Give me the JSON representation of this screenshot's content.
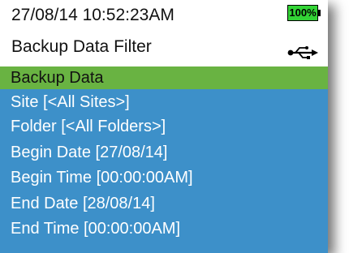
{
  "status": {
    "datetime": "27/08/14  10:52:23AM",
    "battery_label": "100%",
    "battery_level": 1.0
  },
  "header": {
    "title": "Backup Data Filter",
    "icon": "usb-icon"
  },
  "menu": {
    "items": [
      {
        "label": "Backup Data",
        "selected": true
      },
      {
        "label": "Site [<All Sites>]"
      },
      {
        "label": "Folder [<All Folders>]"
      },
      {
        "label": "Begin Date [27/08/14]"
      },
      {
        "label": "Begin Time [00:00:00AM]"
      },
      {
        "label": "End Date [28/08/14]"
      },
      {
        "label": "End Time [00:00:00AM]"
      }
    ]
  },
  "colors": {
    "menu_background": "#3d90c9",
    "selected_background": "#69b342",
    "battery_fill": "#33d436"
  }
}
